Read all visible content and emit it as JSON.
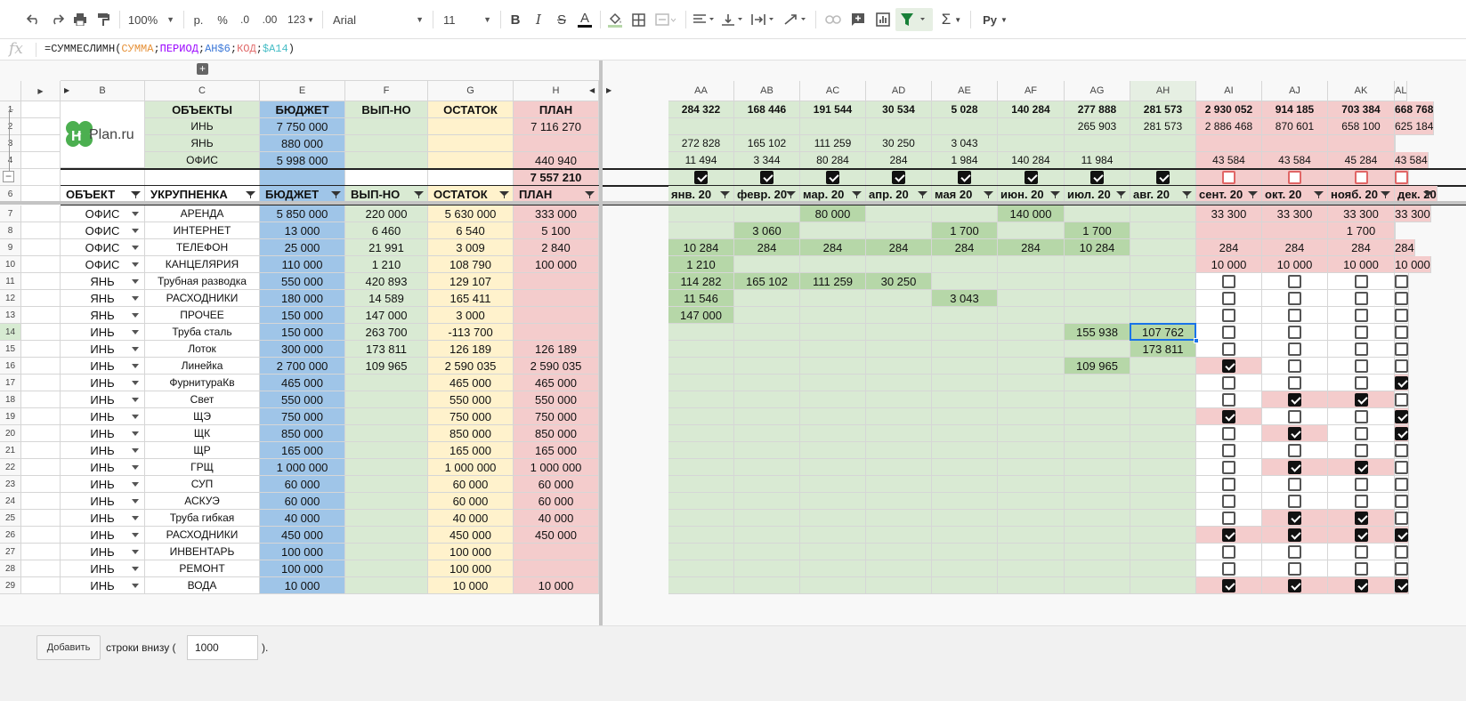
{
  "toolbar": {
    "zoom": "100%",
    "currency": "р.",
    "percent": "%",
    "dec_less": ".0",
    "dec_more": ".00",
    "format": "123",
    "font": "Arial",
    "size": "11",
    "script": "Ру"
  },
  "formula": {
    "fn": "=СУММЕСЛИМН(",
    "a1": "СУММА",
    "sep": ";",
    "a2": "ПЕРИОД",
    "a3": "AH$6",
    "a4": "КОД",
    "a5": "$A14",
    "end": ")"
  },
  "logo": {
    "text": "Plan.ru"
  },
  "colors": {
    "green": "#d9ead3",
    "blue": "#9fc5e8",
    "yellow": "#fff2cc",
    "pink": "#f4cccc",
    "selection": "#1a73e8"
  },
  "col_headers": [
    "B",
    "C",
    "E",
    "F",
    "G",
    "H",
    "AA",
    "AB",
    "AC",
    "AD",
    "AE",
    "AF",
    "AG",
    "AH",
    "AI",
    "AJ",
    "AK",
    "AL"
  ],
  "row_headers": [
    "1",
    "2",
    "3",
    "4",
    "5",
    "6",
    "7",
    "8",
    "9",
    "10",
    "11",
    "12",
    "13",
    "14",
    "15",
    "16",
    "17",
    "18",
    "19",
    "20",
    "21",
    "22",
    "23",
    "24",
    "25",
    "26",
    "27",
    "28",
    "29"
  ],
  "top": {
    "r1": {
      "c": "ОБЪЕКТЫ",
      "e": "БЮДЖЕТ",
      "f": "ВЫП-НО",
      "g": "ОСТАТОК",
      "h": "ПЛАН",
      "m": [
        "284 322",
        "168 446",
        "191 544",
        "30 534",
        "5 028",
        "140 284",
        "277 888",
        "281 573",
        "2 930 052",
        "914 185",
        "703 384",
        "668 768"
      ]
    },
    "r2": {
      "c": "ИНЬ",
      "e": "7 750 000",
      "h": "7 116 270",
      "m": [
        "",
        "",
        "",
        "",
        "",
        "",
        "265 903",
        "281 573",
        "2 886 468",
        "870 601",
        "658 100",
        "625 184"
      ]
    },
    "r3": {
      "c": "ЯНЬ",
      "e": "880 000",
      "h": "",
      "m": [
        "272 828",
        "165 102",
        "111 259",
        "30 250",
        "3 043",
        "",
        "",
        "",
        "",
        "",
        "",
        ""
      ]
    },
    "r4": {
      "c": "ОФИС",
      "e": "5 998 000",
      "h": "440 940",
      "m": [
        "11 494",
        "3 344",
        "80 284",
        "284",
        "1 984",
        "140 284",
        "11 984",
        "",
        "43 584",
        "43 584",
        "45 284",
        "43 584"
      ]
    },
    "r5": {
      "h": "7 557 210"
    }
  },
  "headers": {
    "b": "ОБЪЕКТ",
    "c": "УКРУПНЕНКА",
    "e": "БЮДЖЕТ",
    "f": "ВЫП-НО",
    "g": "ОСТАТОК",
    "h": "ПЛАН",
    "months": [
      "янв. 20",
      "февр. 20",
      "мар. 20",
      "апр. 20",
      "мая 20",
      "июн. 20",
      "июл. 20",
      "авг. 20",
      "сент. 20",
      "окт. 20",
      "нояб. 20",
      "дек. 20"
    ]
  },
  "rows": [
    {
      "b": "ОФИС",
      "c": "АРЕНДА",
      "e": "5 850 000",
      "f": "220 000",
      "g": "5 630 000",
      "h": "333 000",
      "m": [
        "",
        "",
        "80 000",
        "",
        "",
        "140 000",
        "",
        "",
        "33 300",
        "33 300",
        "33 300",
        "33 300"
      ]
    },
    {
      "b": "ОФИС",
      "c": "ИНТЕРНЕТ",
      "e": "13 000",
      "f": "6 460",
      "g": "6 540",
      "h": "5 100",
      "m": [
        "",
        "3 060",
        "",
        "",
        "1 700",
        "",
        "1 700",
        "",
        "",
        "",
        "1 700",
        ""
      ]
    },
    {
      "b": "ОФИС",
      "c": "ТЕЛЕФОН",
      "e": "25 000",
      "f": "21 991",
      "g": "3 009",
      "h": "2 840",
      "m": [
        "10 284",
        "284",
        "284",
        "284",
        "284",
        "284",
        "10 284",
        "",
        "284",
        "284",
        "284",
        "284"
      ]
    },
    {
      "b": "ОФИС",
      "c": "КАНЦЕЛЯРИЯ",
      "e": "110 000",
      "f": "1 210",
      "g": "108 790",
      "h": "100 000",
      "m": [
        "1 210",
        "",
        "",
        "",
        "",
        "",
        "",
        "",
        "10 000",
        "10 000",
        "10 000",
        "10 000"
      ]
    },
    {
      "b": "ЯНЬ",
      "c": "Трубная разводка",
      "e": "550 000",
      "f": "420 893",
      "g": "129 107",
      "h": "",
      "m": [
        "114 282",
        "165 102",
        "111 259",
        "30 250",
        "",
        "",
        "",
        "",
        "",
        "",
        "",
        ""
      ]
    },
    {
      "b": "ЯНЬ",
      "c": "РАСХОДНИКИ",
      "e": "180 000",
      "f": "14 589",
      "g": "165 411",
      "h": "",
      "m": [
        "11 546",
        "",
        "",
        "",
        "3 043",
        "",
        "",
        "",
        "",
        "",
        "",
        ""
      ]
    },
    {
      "b": "ЯНЬ",
      "c": "ПРОЧЕЕ",
      "e": "150 000",
      "f": "147 000",
      "g": "3 000",
      "h": "",
      "m": [
        "147 000",
        "",
        "",
        "",
        "",
        "",
        "",
        "",
        "",
        "",
        "",
        ""
      ]
    },
    {
      "b": "ИНЬ",
      "c": "Труба сталь",
      "e": "150 000",
      "f": "263 700",
      "g": "-113 700",
      "h": "",
      "m": [
        "",
        "",
        "",
        "",
        "",
        "",
        "155 938",
        "107 762",
        "",
        "",
        "",
        ""
      ]
    },
    {
      "b": "ИНЬ",
      "c": "Лоток",
      "e": "300 000",
      "f": "173 811",
      "g": "126 189",
      "h": "126 189",
      "m": [
        "",
        "",
        "",
        "",
        "",
        "",
        "",
        "173 811",
        "",
        "",
        "",
        ""
      ]
    },
    {
      "b": "ИНЬ",
      "c": "Линейка",
      "e": "2 700 000",
      "f": "109 965",
      "g": "2 590 035",
      "h": "2 590 035",
      "m": [
        "",
        "",
        "",
        "",
        "",
        "",
        "109 965",
        "",
        "",
        "",
        "",
        ""
      ]
    },
    {
      "b": "ИНЬ",
      "c": "ФурнитураКв",
      "e": "465 000",
      "f": "",
      "g": "465 000",
      "h": "465 000",
      "m": [
        "",
        "",
        "",
        "",
        "",
        "",
        "",
        "",
        "",
        "",
        "",
        ""
      ]
    },
    {
      "b": "ИНЬ",
      "c": "Свет",
      "e": "550 000",
      "f": "",
      "g": "550 000",
      "h": "550 000",
      "m": [
        "",
        "",
        "",
        "",
        "",
        "",
        "",
        "",
        "",
        "",
        "",
        ""
      ]
    },
    {
      "b": "ИНЬ",
      "c": "ЩЭ",
      "e": "750 000",
      "f": "",
      "g": "750 000",
      "h": "750 000",
      "m": [
        "",
        "",
        "",
        "",
        "",
        "",
        "",
        "",
        "",
        "",
        "",
        ""
      ]
    },
    {
      "b": "ИНЬ",
      "c": "ЩК",
      "e": "850 000",
      "f": "",
      "g": "850 000",
      "h": "850 000",
      "m": [
        "",
        "",
        "",
        "",
        "",
        "",
        "",
        "",
        "",
        "",
        "",
        ""
      ]
    },
    {
      "b": "ИНЬ",
      "c": "ЩР",
      "e": "165 000",
      "f": "",
      "g": "165 000",
      "h": "165 000",
      "m": [
        "",
        "",
        "",
        "",
        "",
        "",
        "",
        "",
        "",
        "",
        "",
        ""
      ]
    },
    {
      "b": "ИНЬ",
      "c": "ГРЩ",
      "e": "1 000 000",
      "f": "",
      "g": "1 000 000",
      "h": "1 000 000",
      "m": [
        "",
        "",
        "",
        "",
        "",
        "",
        "",
        "",
        "",
        "",
        "",
        ""
      ]
    },
    {
      "b": "ИНЬ",
      "c": "СУП",
      "e": "60 000",
      "f": "",
      "g": "60 000",
      "h": "60 000",
      "m": [
        "",
        "",
        "",
        "",
        "",
        "",
        "",
        "",
        "",
        "",
        "",
        ""
      ]
    },
    {
      "b": "ИНЬ",
      "c": "АСКУЭ",
      "e": "60 000",
      "f": "",
      "g": "60 000",
      "h": "60 000",
      "m": [
        "",
        "",
        "",
        "",
        "",
        "",
        "",
        "",
        "",
        "",
        "",
        ""
      ]
    },
    {
      "b": "ИНЬ",
      "c": "Труба гибкая",
      "e": "40 000",
      "f": "",
      "g": "40 000",
      "h": "40 000",
      "m": [
        "",
        "",
        "",
        "",
        "",
        "",
        "",
        "",
        "",
        "",
        "",
        ""
      ]
    },
    {
      "b": "ИНЬ",
      "c": "РАСХОДНИКИ",
      "e": "450 000",
      "f": "",
      "g": "450 000",
      "h": "450 000",
      "m": [
        "",
        "",
        "",
        "",
        "",
        "",
        "",
        "",
        "",
        "",
        "",
        ""
      ]
    },
    {
      "b": "ИНЬ",
      "c": "ИНВЕНТАРЬ",
      "e": "100 000",
      "f": "",
      "g": "100 000",
      "h": "",
      "m": [
        "",
        "",
        "",
        "",
        "",
        "",
        "",
        "",
        "",
        "",
        "",
        ""
      ]
    },
    {
      "b": "ИНЬ",
      "c": "РЕМОНТ",
      "e": "100 000",
      "f": "",
      "g": "100 000",
      "h": "",
      "m": [
        "",
        "",
        "",
        "",
        "",
        "",
        "",
        "",
        "",
        "",
        "",
        ""
      ]
    },
    {
      "b": "ИНЬ",
      "c": "ВОДА",
      "e": "10 000",
      "f": "",
      "g": "10 000",
      "h": "10 000",
      "m": [
        "",
        "",
        "",
        "",
        "",
        "",
        "",
        "",
        "",
        "",
        "",
        ""
      ]
    }
  ],
  "checkboxes": {
    "r11": [
      false,
      false,
      false,
      false
    ],
    "r12": [
      false,
      false,
      false,
      false
    ],
    "r13": [
      false,
      false,
      false,
      false
    ],
    "r14": [
      false,
      false,
      false,
      false
    ],
    "r15": [
      false,
      false,
      false,
      false
    ],
    "r16": [
      true,
      false,
      false,
      false
    ],
    "r17": [
      false,
      false,
      false,
      true
    ],
    "r18": [
      false,
      true,
      true,
      false
    ],
    "r19": [
      true,
      false,
      false,
      true
    ],
    "r20": [
      false,
      true,
      false,
      true
    ],
    "r21": [
      false,
      false,
      false,
      false
    ],
    "r22": [
      false,
      true,
      true,
      false
    ],
    "r23": [
      false,
      false,
      false,
      false
    ],
    "r24": [
      false,
      false,
      false,
      false
    ],
    "r25": [
      false,
      true,
      true,
      false
    ],
    "r26": [
      true,
      true,
      true,
      true
    ],
    "r27": [
      false,
      false,
      false,
      false
    ],
    "r28": [
      false,
      false,
      false,
      false
    ],
    "r29": [
      true,
      true,
      true,
      true
    ]
  },
  "bottom": {
    "button": "Добавить",
    "text": "строки внизу (",
    "value": "1000",
    "end": ")."
  }
}
